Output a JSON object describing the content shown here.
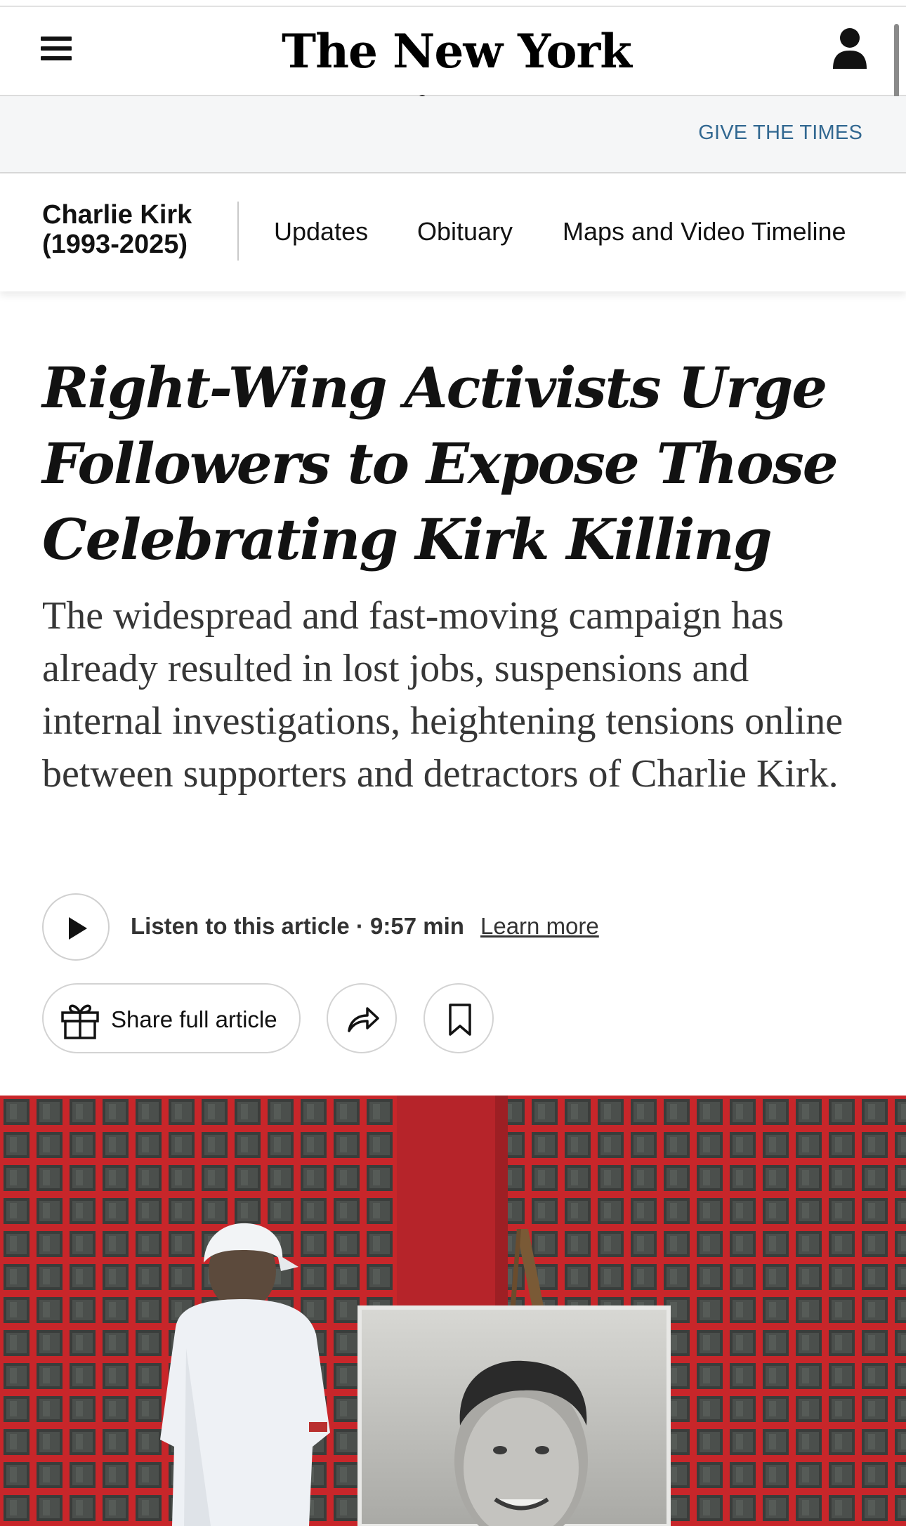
{
  "masthead": {
    "logo_text": "The New York Times",
    "menu_icon": "hamburger-menu-icon",
    "account_icon": "account-person-icon"
  },
  "promo": {
    "link_text": "GIVE THE TIMES"
  },
  "subnav": {
    "title_line1": "Charlie Kirk",
    "title_line2": "(1993-2025)",
    "items": [
      {
        "label": "Updates"
      },
      {
        "label": "Obituary"
      },
      {
        "label": "Maps and Video Timeline"
      }
    ]
  },
  "article": {
    "headline": "Right-Wing Activists Urge Followers to Expose Those Celebrating Kirk Killing",
    "summary": "The widespread and fast-moving campaign has already resulted in lost jobs, suspensions and internal investigations, heightening tensions online between supporters and detractors of Charlie Kirk."
  },
  "audio": {
    "play_icon": "play-icon",
    "listen_label": "Listen to this article · 9:57 min",
    "learn_more": "Learn more"
  },
  "actions": {
    "share_label": "Share full article",
    "gift_icon": "gift-icon",
    "share_icon": "share-arrow-icon",
    "bookmark_icon": "bookmark-icon"
  },
  "colors": {
    "promo_link": "#326891",
    "promo_band": "#f5f6f7",
    "image_grid_red": "#c8262a"
  }
}
